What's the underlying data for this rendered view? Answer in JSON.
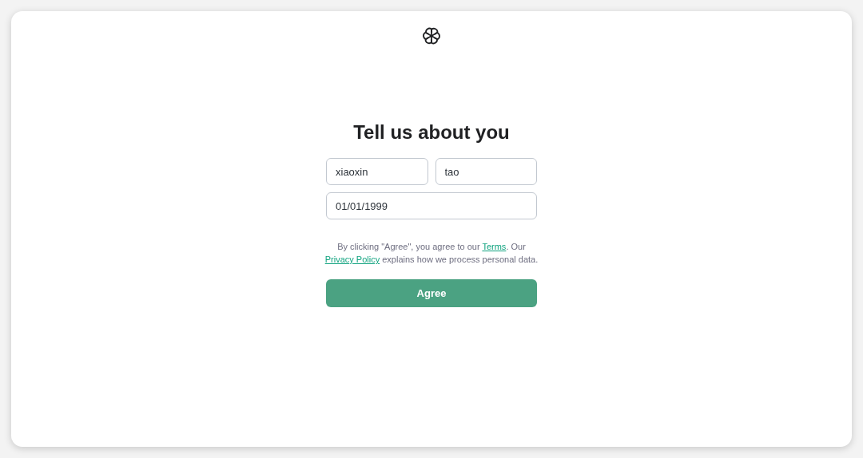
{
  "title": "Tell us about you",
  "fields": [
    {
      "value": "xiaoxin"
    },
    {
      "value": "tao"
    },
    {
      "value": "01/01/1999"
    }
  ],
  "legal": [
    {
      "kind": "text",
      "text": "By clicking \"Agree\", you agree to our "
    },
    {
      "kind": "link",
      "text": "Terms"
    },
    {
      "kind": "text",
      "text": ". Our "
    },
    {
      "kind": "link",
      "text": "Privacy Policy"
    },
    {
      "kind": "text",
      "text": " explains how we process personal data."
    }
  ],
  "button": "Agree"
}
